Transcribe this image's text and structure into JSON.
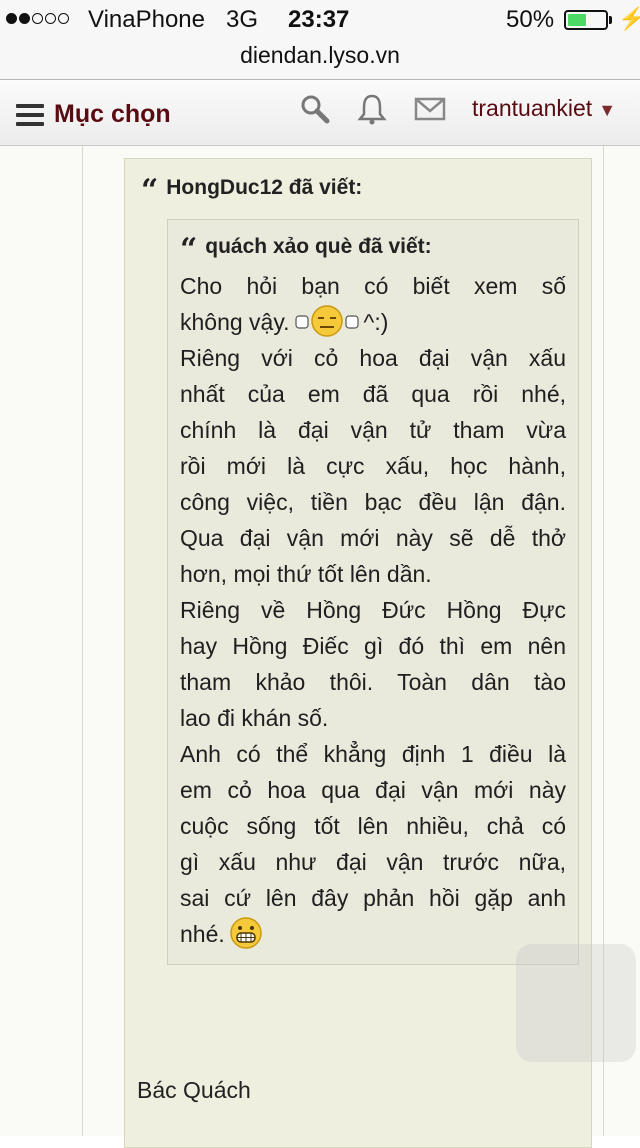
{
  "status_bar": {
    "carrier": "VinaPhone",
    "network": "3G",
    "time": "23:37",
    "battery_percent": "50%",
    "battery_level": 0.5
  },
  "browser": {
    "url": "diendan.lyso.vn"
  },
  "header": {
    "menu_label": "Mục chọn",
    "icons": [
      "search-icon",
      "bell-icon",
      "mail-icon"
    ],
    "username": "trantuankiet",
    "user_caret": "▼"
  },
  "post": {
    "quote_author_line": "HongDuc12 đã viết:",
    "inner_quote": {
      "author_line": "quách xảo què đã viết:",
      "lines": [
        "Cho hỏi bạn có biết xem số",
        "không vậy.",
        "Riêng với cỏ hoa đại vận xấu",
        "nhất của em đã qua rồi nhé,",
        "chính là đại vận tử tham vừa",
        "rồi mới là cực xấu, học hành,",
        "công việc, tiền bạc đều lận đận.",
        "Qua đại vận mới này sẽ dễ thở",
        "hơn, mọi thứ tốt lên dần.",
        "Riêng về Hồng Đức Hồng Đực",
        "hay Hồng Điếc gì đó thì em nên",
        "tham khảo thôi. Toàn dân tào",
        "lao đi khán số.",
        "Anh có thể khẳng định 1 điều là",
        "em cỏ hoa qua đại vận mới này",
        "cuộc sống tốt lên nhiều, chả có",
        "gì xấu như đại vận trước nữa,",
        "sai cứ lên đây phản hồi gặp anh",
        "nhé."
      ],
      "emoticon_suffix": "^:)"
    },
    "signature": "Bác Quách"
  },
  "colors": {
    "brand": "#5a0b12",
    "quote_bg": "#efefdf",
    "inner_quote_bg": "#e9e9dc",
    "battery_green": "#4cd964"
  }
}
